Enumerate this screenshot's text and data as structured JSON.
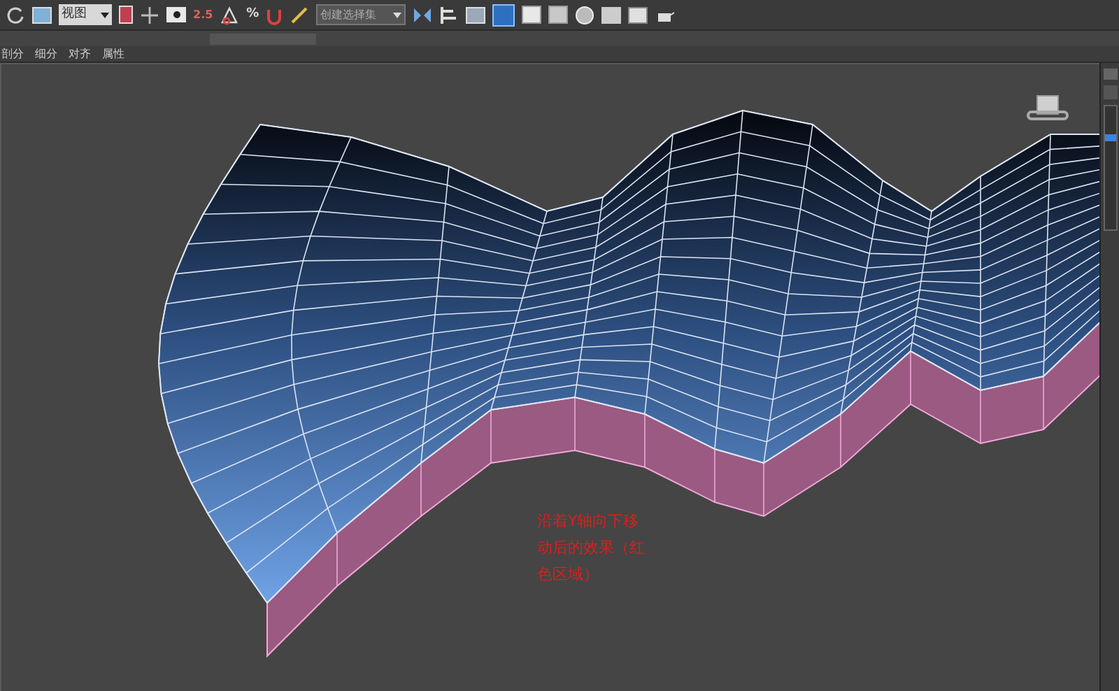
{
  "toolbar": {
    "view_dropdown": "视图",
    "snap_labels": [
      "2.5",
      "%"
    ],
    "selection_set_dropdown": "创建选择集"
  },
  "ribbon_tabs": [
    {
      "label": "剖分",
      "selected": false
    },
    {
      "label": "细分",
      "selected": false
    },
    {
      "label": "对齐",
      "selected": false
    },
    {
      "label": "属性",
      "selected": false
    }
  ],
  "viewport": {
    "annotation": {
      "lines": [
        "沿着Y轴向下移",
        "动后的效果（红",
        "色区域）"
      ]
    }
  }
}
